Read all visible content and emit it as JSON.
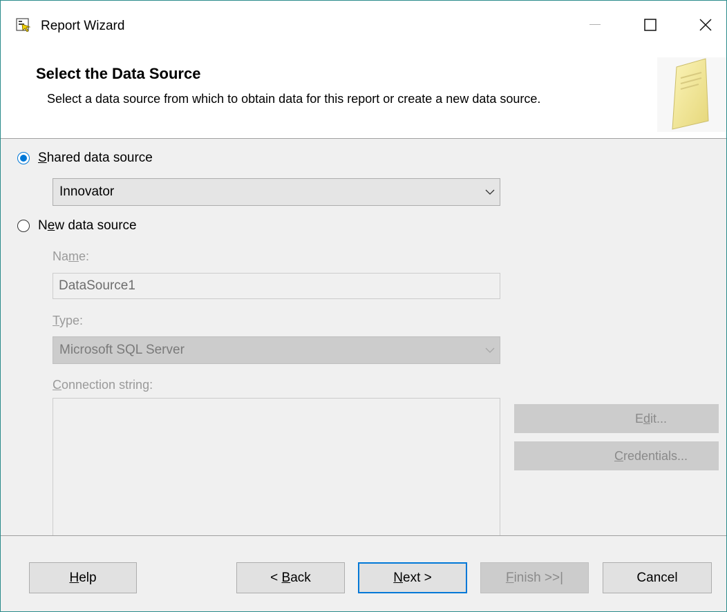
{
  "window": {
    "title": "Report Wizard",
    "icon": "report-wizard-icon",
    "controls": [
      "minimize-icon",
      "maximize-icon",
      "close-icon"
    ]
  },
  "header": {
    "title": "Select the Data Source",
    "description": "Select a data source from which to obtain data for this report or create a new data source.",
    "art_icon": "report-document-icon"
  },
  "shared": {
    "label_access": "S",
    "label_rest": "hared data source",
    "selected": true,
    "combo_value": "Innovator"
  },
  "new_source": {
    "label_first": "N",
    "label_access": "e",
    "label_rest": "w data source",
    "selected": false,
    "name_label_pre": "Na",
    "name_label_access": "m",
    "name_label_post": "e:",
    "name_value": "DataSource1",
    "type_label_access": "T",
    "type_label_rest": "ype:",
    "type_value": "Microsoft SQL Server",
    "conn_label_access": "C",
    "conn_label_rest": "onnection string:",
    "conn_value": "",
    "edit_pre": "E",
    "edit_access": "d",
    "edit_post": "it...",
    "cred_access": "C",
    "cred_rest": "redentials..."
  },
  "footer": {
    "help_access": "H",
    "help_rest": "elp",
    "back_pre": "< ",
    "back_access": "B",
    "back_rest": "ack",
    "next_access": "N",
    "next_rest": "ext >",
    "finish_access": "F",
    "finish_rest": "inish >>|",
    "cancel": "Cancel"
  },
  "colors": {
    "accent": "#0078d7",
    "window_border": "#2a8b8b",
    "face": "#f0f0f0",
    "disabled_face": "#cccccc"
  }
}
